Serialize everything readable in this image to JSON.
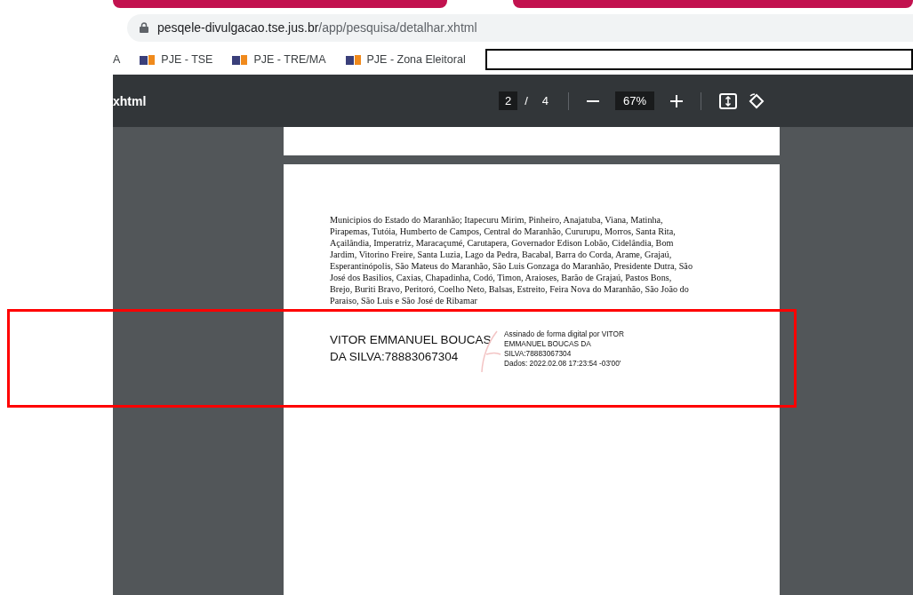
{
  "address_bar": {
    "domain": "pesqele-divulgacao.tse.jus.br",
    "path": "/app/pesquisa/detalhar.xhtml"
  },
  "bookmarks": [
    {
      "label": "A",
      "icon": false
    },
    {
      "label": "PJE - TSE",
      "icon": true
    },
    {
      "label": "PJE - TRE/MA",
      "icon": true
    },
    {
      "label": "PJE - Zona Eleitoral",
      "icon": true
    }
  ],
  "pdf_toolbar": {
    "title": "xhtml",
    "page": "2",
    "separator": "/",
    "total_pages": "4",
    "zoom": "67%"
  },
  "document": {
    "paragraph_lines": [
      "Municipios do Estado do Maranhão; Itapecuru Mirim, Pinheiro, Anajatuba, Viana, Matinha,",
      "Pirapemas, Tutóia, Humberto de Campos, Central do Maranhão, Cururupu, Morros, Santa Rita,",
      "Açailândia, Imperatriz, Maracaçumé, Carutapera, Governador Edison Lobão, Cidelândia, Bom",
      "Jardim, Vitorino Freire, Santa Luzia, Lago da Pedra, Bacabal, Barra do Corda, Arame, Grajaú,",
      "Esperantinópolis, São Mateus do Maranhão, São Luis Gonzaga do Maranhão, Presidente Dutra, São",
      "José dos Basilios, Caxias, Chapadinha, Codó, Timon, Araioses, Barão de Grajaú, Pastos Bons,",
      "Brejo, Buriti Bravo, Peritoró, Coelho Neto, Balsas, Estreito, Feira Nova do Maranhão, São João do",
      "Paraiso, São Luis e São José de Ribamar"
    ],
    "signature": {
      "name_lines": [
        "VITOR EMMANUEL BOUCAS",
        "DA SILVA:78883067304"
      ],
      "detail_lines": [
        "Assinado de forma digital por VITOR",
        "EMMANUEL BOUCAS DA",
        "SILVA:78883067304",
        "Dados: 2022.02.08 17:23:54 -03'00'"
      ]
    }
  },
  "highlight": {
    "kind": "rectangle"
  }
}
